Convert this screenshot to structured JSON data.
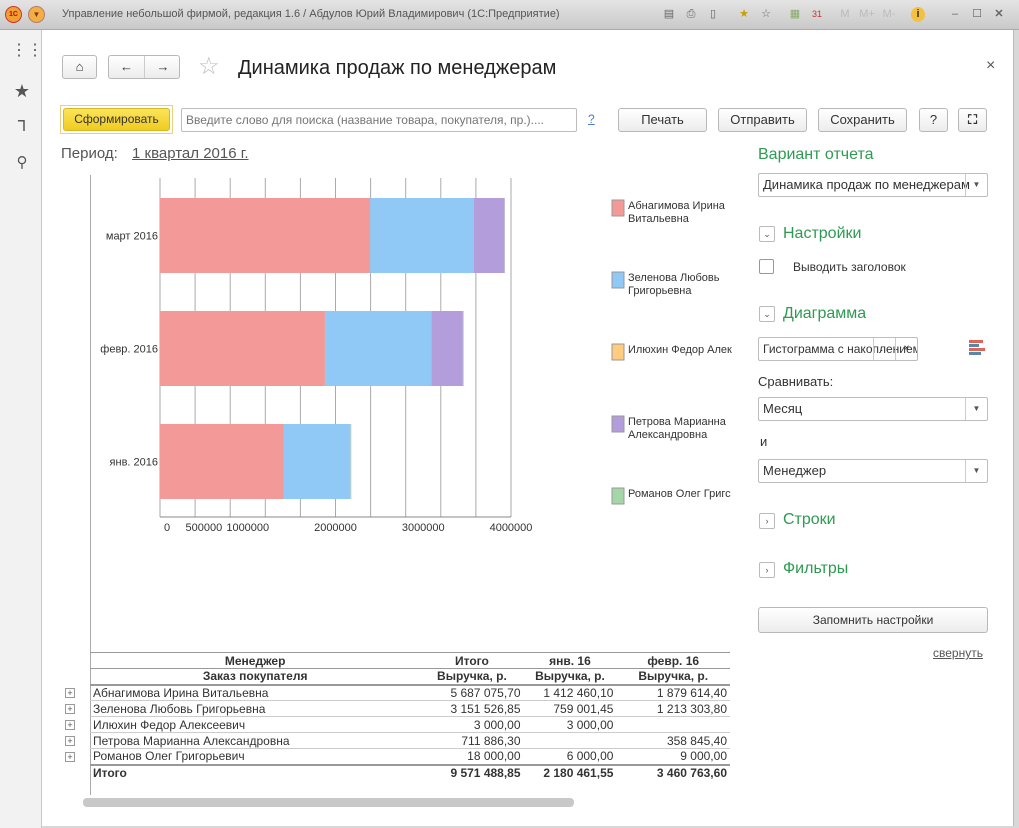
{
  "window": {
    "title": "Управление небольшой фирмой, редакция 1.6 / Абдулов Юрий Владимирович  (1С:Предприятие)",
    "toolbar_icons": [
      "save-icon",
      "print-icon",
      "preview-icon",
      "add-favorite-icon",
      "bookmark-icon",
      "calculator-icon",
      "calendar-icon",
      "m-icon",
      "m-plus-icon",
      "m-minus-icon",
      "info-icon",
      "minimize-icon",
      "maximize-icon",
      "close-icon"
    ],
    "m_labels": [
      "M",
      "M+",
      "M-"
    ]
  },
  "sidebar": {
    "icons": [
      "apps-grid-icon",
      "favorites-star-icon",
      "history-icon",
      "search-icon"
    ]
  },
  "page": {
    "title": "Динамика продаж по менеджерам",
    "close": "×"
  },
  "toolbar": {
    "generate": "Сформировать",
    "search_placeholder": "Введите слово для поиска (название товара, покупателя, пр.)....",
    "help_link": "?",
    "print": "Печать",
    "send": "Отправить",
    "save": "Сохранить",
    "help": "?"
  },
  "period": {
    "label": "Период:",
    "value": "1 квартал 2016 г."
  },
  "colors": {
    "accent_green": "#2e9a52",
    "generate_button": "#f5d83a"
  },
  "chart_data": {
    "type": "bar",
    "orientation": "horizontal",
    "stacked": true,
    "categories": [
      "янв. 2016",
      "февр. 2016",
      "март 2016"
    ],
    "xlim": [
      0,
      4000000
    ],
    "x_tick_labels": [
      "0",
      "500000",
      "1000000",
      "2000000",
      "3000000",
      "4000000"
    ],
    "x_tick_values": [
      0,
      500000,
      1000000,
      2000000,
      3000000,
      4000000
    ],
    "grid": true,
    "legend": "right",
    "series": [
      {
        "name": "Абнагимова Ирина Витальевна",
        "color": "#f39a98",
        "values": [
          1412460.1,
          1879614.4,
          2395001.2
        ]
      },
      {
        "name": "Зеленова Любовь Григорьевна",
        "color": "#90c8f6",
        "values": [
          759001.45,
          1213303.8,
          1179221.6
        ]
      },
      {
        "name": "Илюхин Федор Алексеевич",
        "color": "#ffcc80",
        "values": [
          3000,
          0,
          0
        ]
      },
      {
        "name": "Петрова Марианна Александровна",
        "color": "#b39ddb",
        "values": [
          0,
          358845.4,
          353040.9
        ]
      },
      {
        "name": "Романов Олег Григорьевич",
        "color": "#a5d6a7",
        "values": [
          6000,
          9000,
          3000
        ]
      }
    ],
    "legend_labels": [
      "Абнагимова Ирина\nВитальевна",
      "Зеленова Любовь\nГригорьевна",
      "Илюхин Федор Алек",
      "Петрова Марианна\nАлександровна",
      "Романов Олег Григс"
    ]
  },
  "table": {
    "header1": [
      "Менеджер",
      "Итого",
      "янв. 16",
      "февр. 16"
    ],
    "header2": [
      "Заказ покупателя",
      "Выручка, р.",
      "Выручка, р.",
      "Выручка, р."
    ],
    "rows": [
      {
        "name": "Абнагимова Ирина Витальевна",
        "total": "5 687 075,70",
        "jan": "1 412 460,10",
        "feb": "1 879 614,40"
      },
      {
        "name": "Зеленова Любовь Григорьевна",
        "total": "3 151 526,85",
        "jan": "759 001,45",
        "feb": "1 213 303,80"
      },
      {
        "name": "Илюхин Федор Алексеевич",
        "total": "3 000,00",
        "jan": "3 000,00",
        "feb": ""
      },
      {
        "name": "Петрова Марианна Александровна",
        "total": "711 886,30",
        "jan": "",
        "feb": "358 845,40"
      },
      {
        "name": "Романов Олег Григорьевич",
        "total": "18 000,00",
        "jan": "6 000,00",
        "feb": "9 000,00"
      }
    ],
    "total": {
      "name": "Итого",
      "total": "9 571 488,85",
      "jan": "2 180 461,55",
      "feb": "3 460 763,60"
    }
  },
  "settings": {
    "variant_title": "Вариант отчета",
    "variant_value": "Динамика продаж по менеджерам",
    "settings_title": "Настройки",
    "show_header_label": "Выводить заголовок",
    "show_header_checked": false,
    "chart_title": "Диаграмма",
    "chart_type_value": "Гистограмма с накоплением",
    "chart_type_more": "...",
    "chart_type_clear": "×",
    "compare_label": "Сравнивать:",
    "compare_value": "Месяц",
    "and_label": "и",
    "compare_value2": "Менеджер",
    "rows_title": "Строки",
    "filters_title": "Фильтры",
    "remember": "Запомнить настройки",
    "collapse": "свернуть"
  }
}
